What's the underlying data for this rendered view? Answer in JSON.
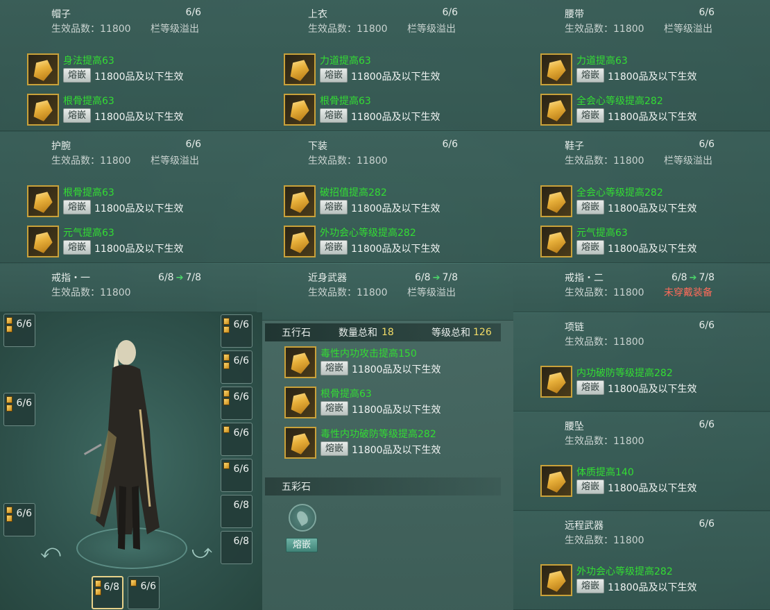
{
  "slots": [
    {
      "key": "hat",
      "name": "帽子",
      "ratio": "6/6",
      "grade_label": "生效品数：11800",
      "overflow": "栏等级溢出",
      "gems": [
        {
          "name": "身法提高63",
          "btn": "熔嵌",
          "eff": "11800品及以下生效"
        },
        {
          "name": "根骨提高63",
          "btn": "熔嵌",
          "eff": "11800品及以下生效"
        }
      ]
    },
    {
      "key": "top",
      "name": "上衣",
      "ratio": "6/6",
      "grade_label": "生效品数：11800",
      "overflow": "栏等级溢出",
      "gems": [
        {
          "name": "力道提高63",
          "btn": "熔嵌",
          "eff": "11800品及以下生效"
        },
        {
          "name": "根骨提高63",
          "btn": "熔嵌",
          "eff": "11800品及以下生效"
        }
      ]
    },
    {
      "key": "belt",
      "name": "腰带",
      "ratio": "6/6",
      "grade_label": "生效品数：11800",
      "overflow": "栏等级溢出",
      "gems": [
        {
          "name": "力道提高63",
          "btn": "熔嵌",
          "eff": "11800品及以下生效"
        },
        {
          "name": "全会心等级提高282",
          "btn": "熔嵌",
          "eff": "11800品及以下生效"
        }
      ]
    },
    {
      "key": "wrist",
      "name": "护腕",
      "ratio": "6/6",
      "grade_label": "生效品数：11800",
      "overflow": "栏等级溢出",
      "gems": [
        {
          "name": "根骨提高63",
          "btn": "熔嵌",
          "eff": "11800品及以下生效"
        },
        {
          "name": "元气提高63",
          "btn": "熔嵌",
          "eff": "11800品及以下生效"
        }
      ]
    },
    {
      "key": "pants",
      "name": "下装",
      "ratio": "6/6",
      "grade_label": "生效品数：11800",
      "overflow": "",
      "gems": [
        {
          "name": "破招值提高282",
          "btn": "熔嵌",
          "eff": "11800品及以下生效"
        },
        {
          "name": "外功会心等级提高282",
          "btn": "熔嵌",
          "eff": "11800品及以下生效"
        }
      ]
    },
    {
      "key": "shoes",
      "name": "鞋子",
      "ratio": "6/6",
      "grade_label": "生效品数：11800",
      "overflow": "栏等级溢出",
      "gems": [
        {
          "name": "全会心等级提高282",
          "btn": "熔嵌",
          "eff": "11800品及以下生效"
        },
        {
          "name": "元气提高63",
          "btn": "熔嵌",
          "eff": "11800品及以下生效"
        }
      ]
    }
  ],
  "ring1": {
    "name": "戒指・一",
    "ratio": "6/8",
    "next": "7/8",
    "grade_label": "生效品数：11800"
  },
  "melee": {
    "name": "近身武器",
    "ratio": "6/8",
    "next": "7/8",
    "grade_label": "生效品数：11800",
    "overflow": "栏等级溢出"
  },
  "ring2": {
    "name": "戒指・二",
    "ratio": "6/8",
    "next": "7/8",
    "grade_label": "生效品数：11800",
    "status": "未穿戴装备"
  },
  "necklace": {
    "name": "项链",
    "ratio": "6/6",
    "grade_label": "生效品数：11800",
    "gem": {
      "name": "内功破防等级提高282",
      "btn": "熔嵌",
      "eff": "11800品及以下生效"
    }
  },
  "pendant": {
    "name": "腰坠",
    "ratio": "6/6",
    "grade_label": "生效品数：11800",
    "gem": {
      "name": "体质提高140",
      "btn": "熔嵌",
      "eff": "11800品及以下生效"
    }
  },
  "ranged": {
    "name": "远程武器",
    "ratio": "6/6",
    "grade_label": "生效品数：11800",
    "gem": {
      "name": "外功会心等级提高282",
      "btn": "熔嵌",
      "eff": "11800品及以下生效"
    }
  },
  "wuxing": {
    "title": "五行石",
    "count_label": "数量总和",
    "count": "18",
    "level_label": "等级总和",
    "level": "126",
    "gems": [
      {
        "name": "毒性内功攻击提高150",
        "btn": "熔嵌",
        "eff": "11800品及以下生效"
      },
      {
        "name": "根骨提高63",
        "btn": "熔嵌",
        "eff": "11800品及以下生效"
      },
      {
        "name": "毒性内功破防等级提高282",
        "btn": "熔嵌",
        "eff": "11800品及以下生效"
      }
    ]
  },
  "wucai": {
    "title": "五彩石",
    "btn": "熔嵌"
  },
  "left_slots": [
    "6/6",
    "6/6",
    "6/6"
  ],
  "right_slots": [
    "6/6",
    "6/6",
    "6/6",
    "6/6",
    "6/6",
    "6/8",
    "6/8"
  ],
  "bottom_slots": [
    "6/8",
    "6/6"
  ],
  "colors": {
    "green": "#33dd33",
    "red": "#ff6b5a",
    "yellow": "#f2dc67",
    "gold_border": "#caa23a"
  }
}
